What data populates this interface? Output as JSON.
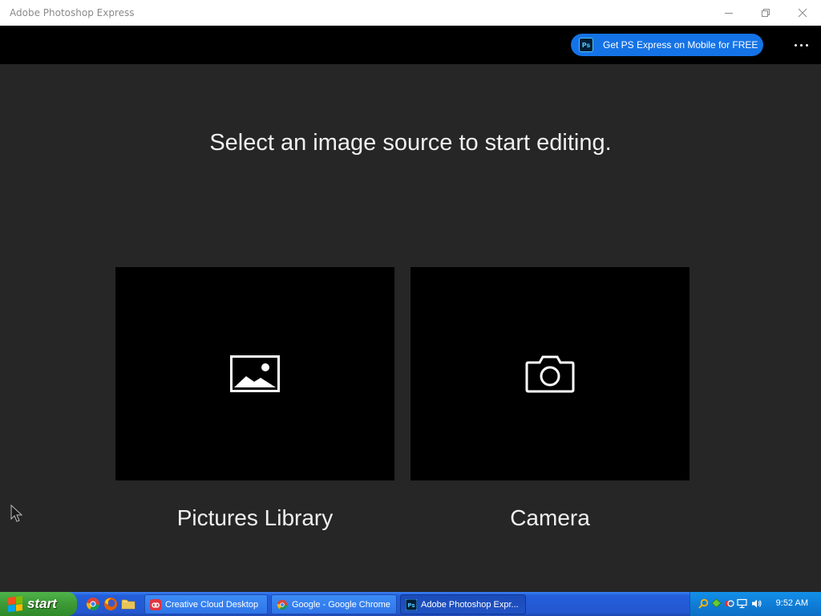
{
  "window": {
    "title": "Adobe Photoshop Express",
    "minimize_icon": "minimize-icon",
    "restore_icon": "restore-icon",
    "close_icon": "close-icon"
  },
  "appbar": {
    "promo_label": "Get PS Express on Mobile for FREE",
    "promo_icon_text": "Ps",
    "more_icon": "more-options-icon"
  },
  "main": {
    "heading": "Select an image source to start editing.",
    "sources": [
      {
        "label": "Pictures Library",
        "icon": "image-icon"
      },
      {
        "label": "Camera",
        "icon": "camera-icon"
      }
    ]
  },
  "taskbar": {
    "start_label": "start",
    "quick_launch": [
      "chrome-icon",
      "firefox-icon",
      "folder-icon"
    ],
    "tasks": [
      {
        "label": "Creative Cloud Desktop",
        "icon": "creative-cloud-icon",
        "active": false
      },
      {
        "label": "Google - Google Chrome",
        "icon": "chrome-icon",
        "active": false
      },
      {
        "label": "Adobe Photoshop Expr...",
        "icon": "photoshop-express-icon",
        "active": true
      }
    ],
    "clock": "9:52 AM"
  },
  "colors": {
    "accent": "#1473e6",
    "background": "#262626",
    "tile": "#000000",
    "appbar": "#000000"
  }
}
